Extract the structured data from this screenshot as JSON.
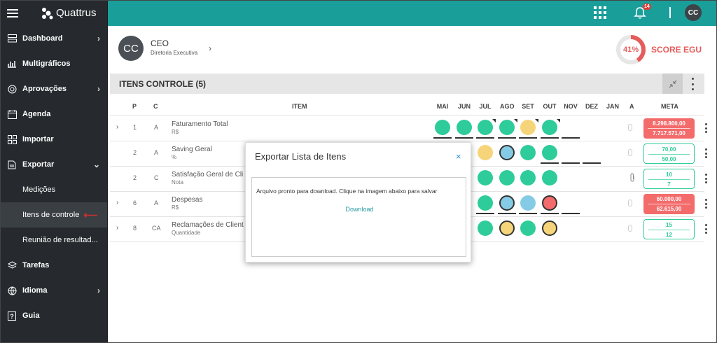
{
  "app": {
    "name": "Quattrus"
  },
  "sidebar": {
    "items": [
      {
        "label": "Dashboard",
        "icon": "dashboard-icon",
        "chevron": "›"
      },
      {
        "label": "Multigráficos",
        "icon": "chart-icon",
        "chevron": ""
      },
      {
        "label": "Aprovações",
        "icon": "target-icon",
        "chevron": "›"
      },
      {
        "label": "Agenda",
        "icon": "calendar-icon",
        "chevron": ""
      },
      {
        "label": "Importar",
        "icon": "import-icon",
        "chevron": ""
      },
      {
        "label": "Exportar",
        "icon": "export-icon",
        "chevron": "⌄"
      },
      {
        "label": "Medições",
        "sub": true
      },
      {
        "label": "Itens de controle",
        "sub": true,
        "active": true
      },
      {
        "label": "Reunião de resultad...",
        "sub": true
      },
      {
        "label": "Tarefas",
        "icon": "layers-icon",
        "chevron": ""
      },
      {
        "label": "Idioma",
        "icon": "globe-icon",
        "chevron": "›"
      },
      {
        "label": "Guia",
        "icon": "help-icon",
        "chevron": ""
      }
    ]
  },
  "topbar": {
    "notifications": "14",
    "user_initials": "CC",
    "accent": "#1a9e9a"
  },
  "profile": {
    "initials": "CC",
    "role": "CEO",
    "department": "Diretoria Executiva"
  },
  "score": {
    "percent_label": "41%",
    "percent": 41,
    "label": "SCORE EGU",
    "color": "#e55c5c"
  },
  "section": {
    "title": "ITENS CONTROLE (5)"
  },
  "table": {
    "headers": {
      "p": "P",
      "c": "C",
      "item": "ITEM",
      "months": [
        "MAI",
        "JUN",
        "JUL",
        "AGO",
        "SET",
        "OUT",
        "NOV",
        "DEZ",
        "JAN"
      ],
      "a": "A",
      "meta": "META"
    },
    "rows": [
      {
        "expand": "›",
        "p": "1",
        "c": "A",
        "name": "Faturamento Total",
        "unit": "R$",
        "meta_top": "8.298.800,00",
        "meta_bottom": "7.717.571,00",
        "meta_style": "red",
        "attach": false
      },
      {
        "expand": "",
        "p": "2",
        "c": "A",
        "name": "Saving Geral",
        "unit": "%",
        "meta_top": "70,00",
        "meta_bottom": "50,00",
        "meta_style": "green",
        "attach": false
      },
      {
        "expand": "",
        "p": "2",
        "c": "C",
        "name": "Satisfação Geral de Cli",
        "unit": "Nota",
        "meta_top": "10",
        "meta_bottom": "7",
        "meta_style": "green",
        "attach": true
      },
      {
        "expand": "›",
        "p": "6",
        "c": "A",
        "name": "Despesas",
        "unit": "R$",
        "meta_top": "60.000,00",
        "meta_bottom": "62.615,00",
        "meta_style": "red",
        "attach": false
      },
      {
        "expand": "›",
        "p": "8",
        "c": "CA",
        "name": "Reclamações de Client",
        "unit": "Quantidade",
        "meta_top": "15",
        "meta_bottom": "12",
        "meta_style": "green",
        "attach": false
      }
    ]
  },
  "modal": {
    "title": "Exportar Lista de Itens",
    "close": "×",
    "message": "Arquivo pronto para download. Clique na imagem abaixo para salvar",
    "link": "Download"
  }
}
